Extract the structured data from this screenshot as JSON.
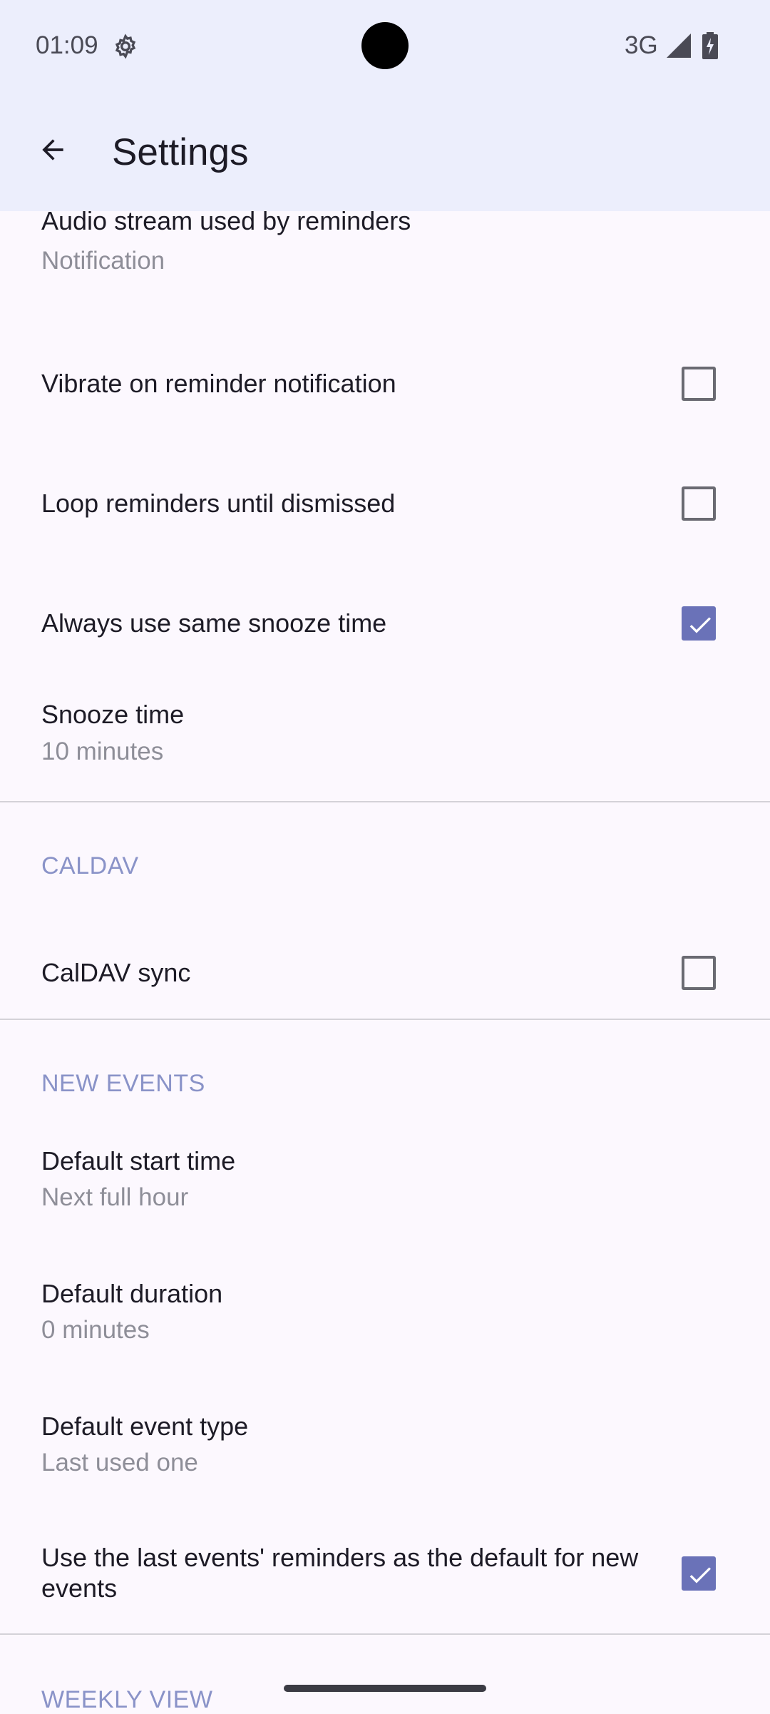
{
  "status_bar": {
    "time": "01:09",
    "network": "3G",
    "icons": [
      "gear-icon",
      "signal-icon",
      "battery-charging-icon"
    ]
  },
  "app_bar": {
    "title": "Settings",
    "back_icon": "arrow-back-icon"
  },
  "settings": {
    "audio_stream": {
      "title": "Audio stream used by reminders",
      "value": "Notification"
    },
    "vibrate": {
      "title": "Vibrate on reminder notification",
      "checked": false
    },
    "loop": {
      "title": "Loop reminders until dismissed",
      "checked": false
    },
    "same_snooze": {
      "title": "Always use same snooze time",
      "checked": true
    },
    "snooze_time": {
      "title": "Snooze time",
      "value": "10 minutes"
    },
    "caldav_header": "CALDAV",
    "caldav_sync": {
      "title": "CalDAV sync",
      "checked": false
    },
    "new_events_header": "NEW EVENTS",
    "default_start": {
      "title": "Default start time",
      "value": "Next full hour"
    },
    "default_duration": {
      "title": "Default duration",
      "value": "0 minutes"
    },
    "default_type": {
      "title": "Default event type",
      "value": "Last used one"
    },
    "last_reminders": {
      "title": "Use the last events' reminders as the default for new events",
      "checked": true
    },
    "weekly_view_header": "WEEKLY VIEW"
  },
  "colors": {
    "accent": "#6a72b8",
    "category_text": "#8a93c8",
    "app_bar_bg": "#eceefc",
    "page_bg": "#fcf8fe"
  }
}
